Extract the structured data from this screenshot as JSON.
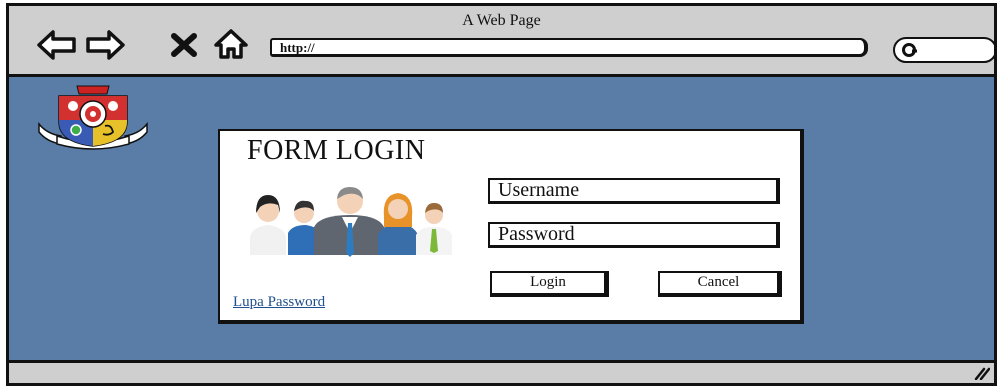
{
  "window": {
    "title": "A Web Page"
  },
  "toolbar": {
    "back_icon": "back-arrow-icon",
    "forward_icon": "forward-arrow-icon",
    "stop_icon": "close-icon",
    "home_icon": "home-icon",
    "url": "http://",
    "search_icon": "search-icon"
  },
  "login": {
    "title": "FORM LOGIN",
    "username_placeholder": "Username",
    "password_placeholder": "Password",
    "login_label": "Login",
    "cancel_label": "Cancel",
    "forgot_label": "Lupa Password"
  },
  "colors": {
    "content_background": "#5a7da8",
    "frame_gray": "#cfcfcf",
    "link": "#1f4f8c"
  }
}
